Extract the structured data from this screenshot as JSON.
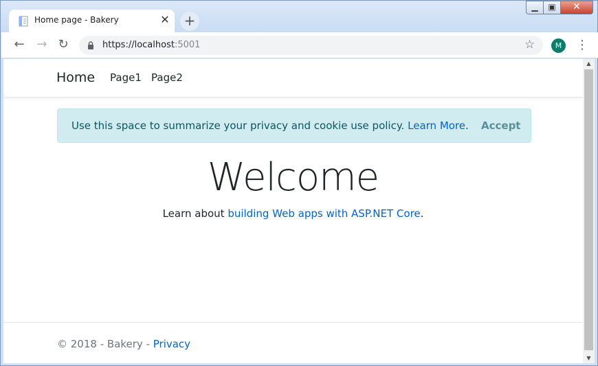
{
  "browser": {
    "tab": {
      "title": "Home page - Bakery",
      "favicon": "document-icon"
    },
    "tab_close_label": "✕",
    "new_tab_label": "+",
    "window_controls": {
      "minimize": "▁",
      "maximize": "▣",
      "close": "✕"
    },
    "back_label": "←",
    "forward_label": "→",
    "reload_label": "↻",
    "address": {
      "scheme_host": "https://localhost",
      "port": ":5001"
    },
    "star_label": "☆",
    "profile_initial": "M",
    "menu_label": "⋮"
  },
  "site": {
    "brand": "Home",
    "nav": [
      "Page1",
      "Page2"
    ],
    "consent": {
      "text": "Use this space to summarize your privacy and cookie use policy.",
      "link": "Learn More",
      "after_link": ".",
      "accept": "Accept"
    },
    "heading": "Welcome",
    "learn": {
      "before": "Learn about ",
      "link": "building Web apps with ASP.NET Core",
      "after": "."
    },
    "footer": {
      "text": "© 2018 - Bakery - ",
      "link": "Privacy"
    }
  },
  "colors": {
    "link": "#0762c8",
    "consent_bg": "#d1ecf1",
    "consent_text": "#0c5460",
    "avatar": "#0b7d69"
  }
}
